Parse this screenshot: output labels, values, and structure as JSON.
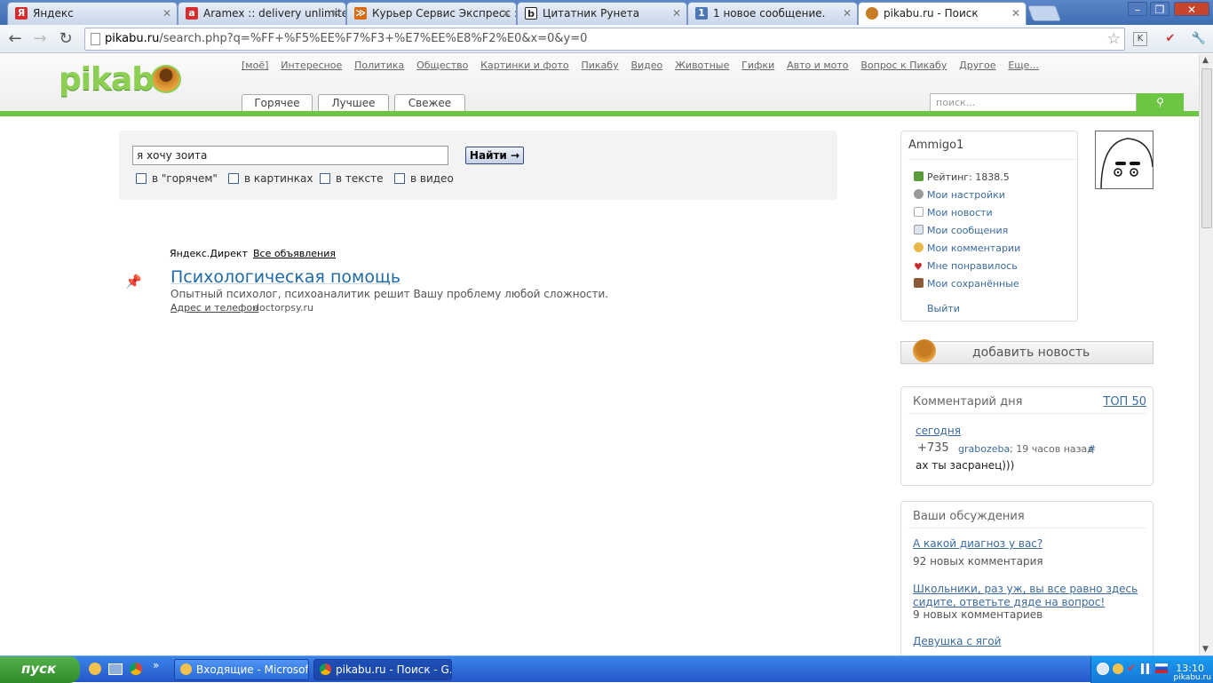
{
  "browser": {
    "tabs": [
      {
        "label": "Яндекс",
        "icon": "yandex-icon",
        "color": "#d62c2c",
        "glyph": "Я"
      },
      {
        "label": "Aramex :: delivery unlimited :",
        "icon": "aramex-icon",
        "color": "#d62c2c",
        "glyph": "a"
      },
      {
        "label": "Курьер Сервис Экспресс : С",
        "icon": "courier-icon",
        "color": "#d96b15",
        "glyph": "≫"
      },
      {
        "label": "Цитатник Рунета",
        "icon": "bash-icon",
        "color": "#222222",
        "glyph": "b"
      },
      {
        "label": "1 новое сообщение.",
        "icon": "mail-icon",
        "color": "#4b78b5",
        "glyph": "1"
      },
      {
        "label": "pikabu.ru - Поиск",
        "icon": "pikabu-icon",
        "color": "#c77c24",
        "glyph": "●",
        "active": true
      }
    ],
    "url_host": "pikabu.ru",
    "url_path": "/search.php?q=%FF+%F5%EE%F7%F3+%E7%EE%E8%F2%E0&x=0&y=0"
  },
  "site": {
    "logo": "pikabu",
    "topnav": [
      "[моё]",
      "Интересное",
      "Политика",
      "Общество",
      "Картинки и фото",
      "Пикабу",
      "Видео",
      "Животные",
      "Гифки",
      "Авто и мото",
      "Вопрос к Пикабу",
      "Другое",
      "Еще..."
    ],
    "tabs": [
      "Горячее",
      "Лучшее",
      "Свежее"
    ],
    "search_placeholder": "поиск..."
  },
  "search": {
    "query": "я хочу зоита",
    "button": "Найти →",
    "options": [
      "в \"горячем\"",
      "в картинках",
      "в тексте",
      "в видео"
    ]
  },
  "ad": {
    "label": "Яндекс.Директ",
    "all_ads": "Все объявления",
    "title": "Психологическая помощь",
    "description": "Опытный психолог, психоаналитик решит Вашу проблему любой сложности.",
    "link": "Адрес и телефон",
    "domain": "doctorpsy.ru"
  },
  "user": {
    "name": "Ammigo1",
    "rating": "Рейтинг: 1838.5",
    "menu": [
      {
        "label": "Мои настройки",
        "icon": "gear-icon",
        "color": "#999999"
      },
      {
        "label": "Мои новости",
        "icon": "page-icon",
        "color": "#cccccc"
      },
      {
        "label": "Мои сообщения",
        "icon": "envelope-icon",
        "color": "#aab8c8"
      },
      {
        "label": "Мои комментарии",
        "icon": "comment-icon",
        "color": "#e6b84a"
      },
      {
        "label": "Мне понравилось",
        "icon": "heart-icon",
        "color": "#cc2a2a"
      },
      {
        "label": "Мои сохранённые",
        "icon": "floppy-icon",
        "color": "#8a5a3a"
      }
    ],
    "logout": "Выйти",
    "add_news": "добавить новость"
  },
  "comment_of_day": {
    "title": "Комментарий дня",
    "top": "ТОП 50",
    "period": "сегодня",
    "score": "+735",
    "author": "grabozeba",
    "time": "; 19 часов назад",
    "hash": "#",
    "text": "ах ты засранец)))"
  },
  "discussions": {
    "title": "Ваши обсуждения",
    "items": [
      {
        "title": "А какой диагноз у вас?",
        "count": "92 новых комментария"
      },
      {
        "title": "Школьники, раз уж, вы все равно здесь сидите, ответьте дяде на вопрос!",
        "count": "9 новых комментариев"
      },
      {
        "title": "Девушка с ягой",
        "count": ""
      }
    ]
  },
  "taskbar": {
    "start": "пуск",
    "tasks": [
      "Входящие - Microsof...",
      "pikabu.ru - Поиск - G..."
    ],
    "clock": "13:10",
    "watermark": "pikabu.ru"
  }
}
